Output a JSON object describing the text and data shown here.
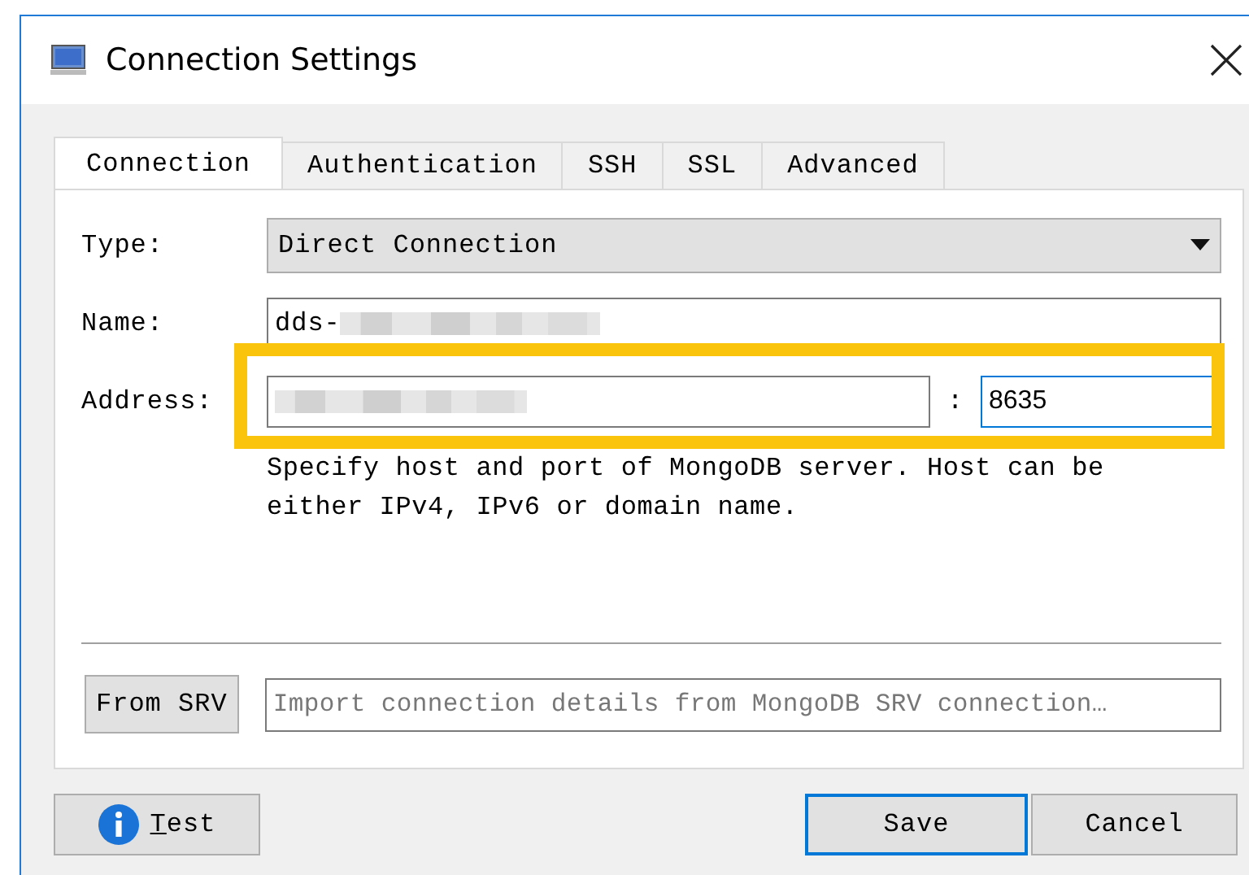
{
  "window": {
    "title": "Connection Settings"
  },
  "tabs": [
    {
      "label": "Connection",
      "selected": true
    },
    {
      "label": "Authentication",
      "selected": false
    },
    {
      "label": "SSH",
      "selected": false
    },
    {
      "label": "SSL",
      "selected": false
    },
    {
      "label": "Advanced",
      "selected": false
    }
  ],
  "type": {
    "label": "Type:",
    "value": "Direct Connection"
  },
  "name": {
    "label": "Name:",
    "value": "dds-",
    "redacted": true
  },
  "address": {
    "label": "Address:",
    "host_redacted": true,
    "separator": ":",
    "port": "8635",
    "port_focused": true,
    "highlighted": true,
    "hint": "Specify host and port of MongoDB server. Host can be either IPv4, IPv6 or domain name."
  },
  "srv": {
    "button": "From SRV",
    "placeholder": "Import connection details from MongoDB SRV connection…"
  },
  "buttons": [
    {
      "label": "Test",
      "kind": "info",
      "access_key_underlined": true,
      "default": false
    },
    {
      "label": "Save",
      "kind": "plain",
      "default": true
    },
    {
      "label": "Cancel",
      "kind": "plain",
      "default": false
    }
  ]
}
